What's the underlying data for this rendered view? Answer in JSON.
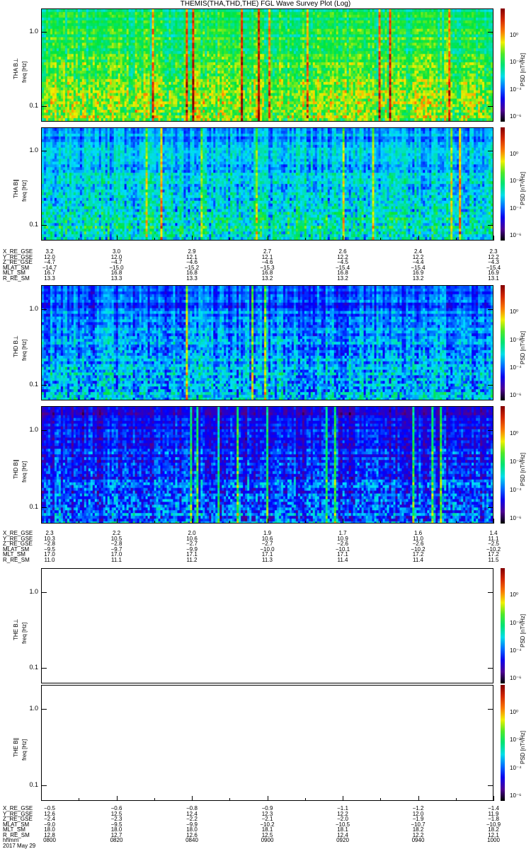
{
  "title": "THEMIS(THA,THD,THE) FGL Wave Survey Plot (Log)",
  "chart_data": {
    "type": "heatmap",
    "title": "THEMIS(THA,THD,THE) FGL Wave Survey Plot (Log)",
    "xlabel": "hhmm",
    "date": "2017 May 29",
    "x_ticks": [
      "0800",
      "0820",
      "0840",
      "0900",
      "0920",
      "0940",
      "1000"
    ],
    "y_ticks": [
      "1.0",
      "0.1"
    ],
    "ylim_hz": [
      0.062,
      2.06
    ],
    "yscale": "log",
    "colorbar": {
      "label": "PSD [nT²/Hz]",
      "ticks": [
        "10⁰",
        "10⁻²",
        "10⁻⁴",
        "10⁻⁶"
      ],
      "log_range": [
        -6.3,
        2
      ],
      "colormap": "rainbow"
    },
    "panels": [
      {
        "probe": "THA",
        "label": "THA B⊥",
        "ylabel": "freq [Hz]",
        "mean_log_psd": -1.6,
        "has_data": true
      },
      {
        "probe": "THA",
        "label": "THA B∥",
        "ylabel": "freq [Hz]",
        "mean_log_psd": -3.0,
        "has_data": true
      },
      {
        "probe": "THD",
        "label": "THD B⊥",
        "ylabel": "freq [Hz]",
        "mean_log_psd": -3.6,
        "has_data": true
      },
      {
        "probe": "THD",
        "label": "THD B∥",
        "ylabel": "freq [Hz]",
        "mean_log_psd": -4.3,
        "has_data": true
      },
      {
        "probe": "THE",
        "label": "THE B⊥",
        "ylabel": "freq [Hz]",
        "has_data": false
      },
      {
        "probe": "THE",
        "label": "THE B∥",
        "ylabel": "freq [Hz]",
        "has_data": false
      }
    ],
    "ephemeris": {
      "labels": [
        "X_RE_GSE",
        "Y_RE_GSE",
        "Z_RE_GSE",
        "MLAT_SM",
        "MLT_SM",
        "R_RE_SM"
      ],
      "THA": [
        [
          "3.2",
          "3.0",
          "2.9",
          "2.7",
          "2.6",
          "2.4",
          "2.3"
        ],
        [
          "12.0",
          "12.0",
          "12.1",
          "12.1",
          "12.2",
          "12.2",
          "12.2"
        ],
        [
          "−4.7",
          "−4.7",
          "−4.6",
          "−4.6",
          "−4.5",
          "−4.4",
          "−4.3"
        ],
        [
          "−14.7",
          "−15.0",
          "−15.2",
          "−15.3",
          "−15.4",
          "−15.4",
          "−15.4"
        ],
        [
          "16.7",
          "16.8",
          "16.8",
          "16.8",
          "16.8",
          "16.9",
          "16.9"
        ],
        [
          "13.3",
          "13.3",
          "13.3",
          "13.2",
          "13.2",
          "13.2",
          "13.1"
        ]
      ],
      "THD": [
        [
          "2.3",
          "2.2",
          "2.0",
          "1.9",
          "1.7",
          "1.6",
          "1.4"
        ],
        [
          "10.3",
          "10.5",
          "10.6",
          "10.6",
          "10.9",
          "11.0",
          "11.1"
        ],
        [
          "−2.8",
          "−2.8",
          "−2.7",
          "−2.7",
          "−2.6",
          "−2.6",
          "−2.5"
        ],
        [
          "−9.5",
          "−9.7",
          "−9.9",
          "−10.0",
          "−10.1",
          "−10.2",
          "−10.2"
        ],
        [
          "17.0",
          "17.0",
          "17.1",
          "17.1",
          "17.1",
          "17.2",
          "17.2"
        ],
        [
          "11.0",
          "11.1",
          "11.2",
          "11.3",
          "11.4",
          "11.4",
          "11.5"
        ]
      ],
      "THE": [
        [
          "−0.5",
          "−0.6",
          "−0.8",
          "−0.9",
          "−1.1",
          "−1.2",
          "−1.4"
        ],
        [
          "12.6",
          "12.5",
          "12.4",
          "12.3",
          "12.2",
          "12.0",
          "11.9"
        ],
        [
          "−2.4",
          "−2.3",
          "−2.2",
          "−2.1",
          "−2.0",
          "−1.9",
          "−1.8"
        ],
        [
          "−9.0",
          "−9.5",
          "−9.9",
          "−10.2",
          "−10.5",
          "−10.7",
          "−10.9"
        ],
        [
          "18.0",
          "18.0",
          "18.0",
          "18.1",
          "18.1",
          "18.2",
          "18.2"
        ],
        [
          "12.8",
          "12.7",
          "12.6",
          "12.5",
          "12.4",
          "12.2",
          "12.1"
        ]
      ]
    }
  }
}
